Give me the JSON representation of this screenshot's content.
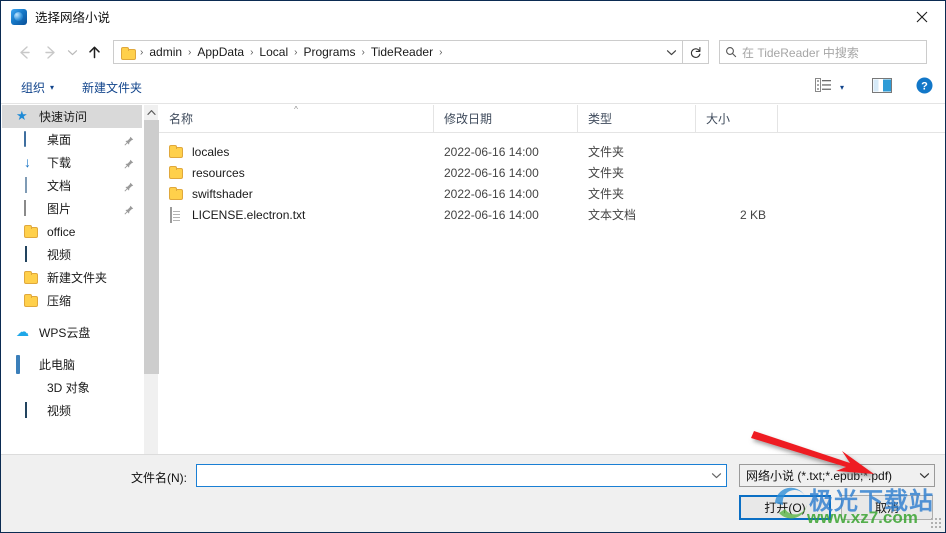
{
  "window": {
    "title": "选择网络小说",
    "app_icon": "app-icon",
    "close_label": "✕"
  },
  "navigation": {
    "back_icon": "back-arrow-icon",
    "forward_icon": "forward-arrow-icon",
    "recent_icon": "chevron-down-icon",
    "up_icon": "up-arrow-icon",
    "breadcrumb": [
      {
        "label": "admin"
      },
      {
        "label": "AppData"
      },
      {
        "label": "Local"
      },
      {
        "label": "Programs"
      },
      {
        "label": "TideReader"
      }
    ],
    "separator": "›",
    "dropdown_icon": "chevron-down-icon",
    "refresh_icon": "refresh-icon"
  },
  "search": {
    "placeholder": "在 TideReader 中搜索",
    "icon": "search-icon"
  },
  "toolbar": {
    "organize_label": "组织",
    "organize_caret": "▾",
    "new_folder_label": "新建文件夹",
    "view_mode_icon": "view-list-icon",
    "view_caret": "▾",
    "preview_pane_icon": "preview-pane-icon",
    "help_icon": "help-icon",
    "help_glyph": "?"
  },
  "sidebar": {
    "items": [
      {
        "label": "快速访问",
        "icon": "pin-star-icon",
        "selected": true,
        "pinned": false,
        "indent": 0
      },
      {
        "label": "桌面",
        "icon": "desktop-icon",
        "selected": false,
        "pinned": true,
        "indent": 1
      },
      {
        "label": "下载",
        "icon": "download-icon",
        "selected": false,
        "pinned": true,
        "indent": 1
      },
      {
        "label": "文档",
        "icon": "documents-icon",
        "selected": false,
        "pinned": true,
        "indent": 1
      },
      {
        "label": "图片",
        "icon": "pictures-icon",
        "selected": false,
        "pinned": true,
        "indent": 1
      },
      {
        "label": "office",
        "icon": "folder-icon",
        "selected": false,
        "pinned": false,
        "indent": 1
      },
      {
        "label": "视频",
        "icon": "video-icon",
        "selected": false,
        "pinned": false,
        "indent": 1
      },
      {
        "label": "新建文件夹",
        "icon": "folder-icon",
        "selected": false,
        "pinned": false,
        "indent": 1
      },
      {
        "label": "压缩",
        "icon": "folder-icon",
        "selected": false,
        "pinned": false,
        "indent": 1
      },
      {
        "label": "WPS云盘",
        "icon": "cloud-icon",
        "selected": false,
        "pinned": false,
        "indent": 0
      },
      {
        "label": "此电脑",
        "icon": "this-pc-icon",
        "selected": false,
        "pinned": false,
        "indent": 0
      },
      {
        "label": "3D 对象",
        "icon": "3d-objects-icon",
        "selected": false,
        "pinned": false,
        "indent": 1
      },
      {
        "label": "视频",
        "icon": "video-icon",
        "selected": false,
        "pinned": false,
        "indent": 1
      }
    ],
    "scroll_up_icon": "chevron-up-icon",
    "scroll_down_icon": "chevron-down-icon"
  },
  "filelist": {
    "columns": [
      {
        "label": "名称",
        "sorted": "asc"
      },
      {
        "label": "修改日期",
        "sorted": ""
      },
      {
        "label": "类型",
        "sorted": ""
      },
      {
        "label": "大小",
        "sorted": ""
      }
    ],
    "sort_caret": "^",
    "rows": [
      {
        "name": "locales",
        "date": "2022-06-16 14:00",
        "type": "文件夹",
        "size": "",
        "icon": "folder-icon"
      },
      {
        "name": "resources",
        "date": "2022-06-16 14:00",
        "type": "文件夹",
        "size": "",
        "icon": "folder-icon"
      },
      {
        "name": "swiftshader",
        "date": "2022-06-16 14:00",
        "type": "文件夹",
        "size": "",
        "icon": "folder-icon"
      },
      {
        "name": "LICENSE.electron.txt",
        "date": "2022-06-16 14:00",
        "type": "文本文档",
        "size": "2 KB",
        "icon": "text-file-icon"
      }
    ]
  },
  "footer": {
    "filename_label": "文件名(N):",
    "filename_value": "",
    "filename_dropdown_icon": "chevron-down-icon",
    "filter_value": "网络小说 (*.txt;*.epub;*.pdf)",
    "filter_dropdown_icon": "chevron-down-icon",
    "open_button": "打开(O)",
    "cancel_button": "取消"
  },
  "annotation": {
    "arrow_color": "#ee1c23",
    "arrow_target": "file-type-filter"
  },
  "watermark": {
    "main": "极光下载站",
    "sub": "www.xz7.com"
  }
}
